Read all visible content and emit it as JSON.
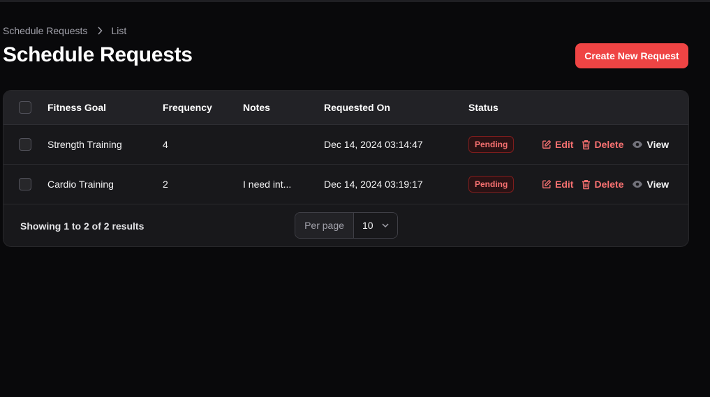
{
  "breadcrumb": {
    "parent": "Schedule Requests",
    "current": "List"
  },
  "page": {
    "title": "Schedule Requests",
    "create_label": "Create New Request"
  },
  "table": {
    "columns": {
      "fitness_goal": "Fitness Goal",
      "frequency": "Frequency",
      "notes": "Notes",
      "requested_on": "Requested On",
      "status": "Status"
    },
    "rows": [
      {
        "fitness_goal": "Strength Training",
        "frequency": "4",
        "notes": "",
        "requested_on": "Dec 14, 2024 03:14:47",
        "status": "Pending"
      },
      {
        "fitness_goal": "Cardio Training",
        "frequency": "2",
        "notes": "I need int...",
        "requested_on": "Dec 14, 2024 03:19:17",
        "status": "Pending"
      }
    ],
    "actions": {
      "edit": "Edit",
      "delete": "Delete",
      "view": "View"
    }
  },
  "footer": {
    "showing": "Showing 1 to 2 of 2 results",
    "per_page_label": "Per page",
    "per_page_value": "10"
  },
  "colors": {
    "accent": "#ef4444",
    "danger_text": "#f87171",
    "background": "#09090b",
    "card": "#18181b"
  }
}
